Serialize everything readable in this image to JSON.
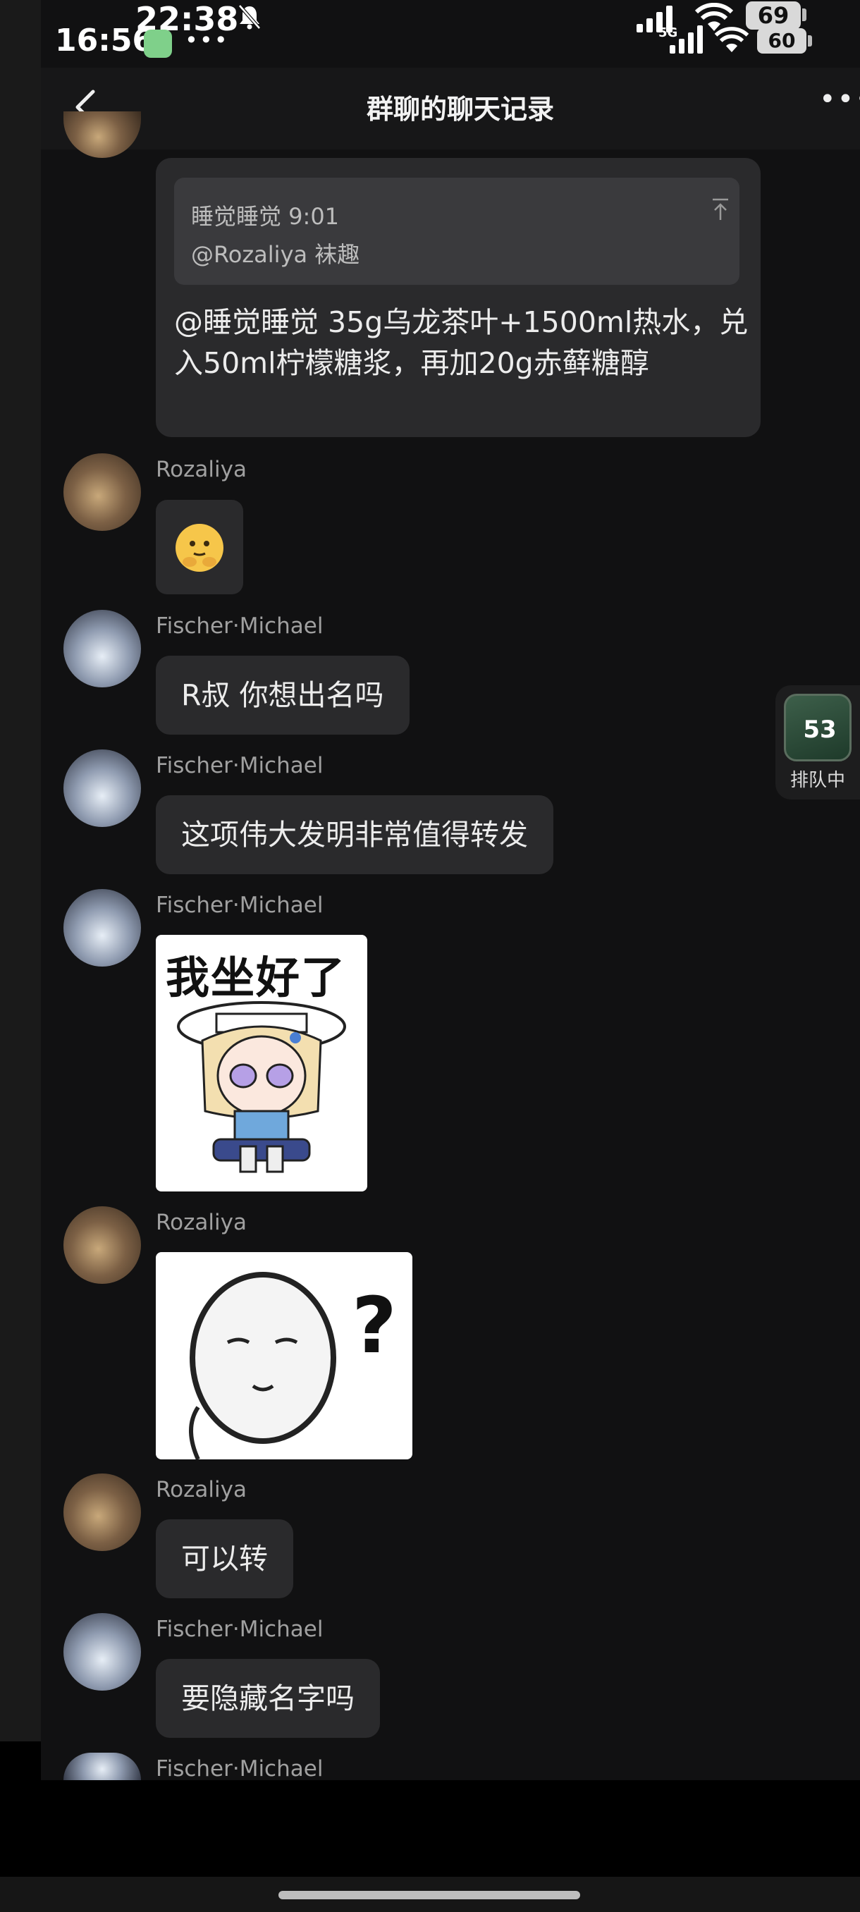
{
  "status_outer": {
    "time": "16:56",
    "dots": "•••",
    "battery": "60"
  },
  "status_inner": {
    "time": "22:38",
    "network": "5G",
    "battery": "69"
  },
  "header": {
    "title": "群聊的聊天记录"
  },
  "quote": {
    "author_time": "睡觉睡觉 9:01",
    "quoted_text": "@Rozaliya 袜趣",
    "reply_text": "@睡觉睡觉 35g乌龙茶叶+1500ml热水，兑入50ml柠檬糖浆，再加20g赤藓糖醇"
  },
  "messages": [
    {
      "sender": "Rozaliya",
      "type": "emoji"
    },
    {
      "sender": "Fischer·Michael",
      "text": "R叔 你想出名吗"
    },
    {
      "sender": "Fischer·Michael",
      "text": "这项伟大发明非常值得转发"
    },
    {
      "sender": "Fischer·Michael",
      "type": "sticker",
      "caption": "我坐好了"
    },
    {
      "sender": "Rozaliya",
      "type": "sticker",
      "caption": "?"
    },
    {
      "sender": "Rozaliya",
      "text": "可以转"
    },
    {
      "sender": "Fischer·Michael",
      "text": "要隐藏名字吗"
    },
    {
      "sender": "Fischer·Michael"
    }
  ],
  "float_badge": {
    "count": "53",
    "label": "排队中"
  },
  "icons": [
    "back-icon",
    "more-icon",
    "bell-off-icon",
    "signal-icon",
    "wifi-icon",
    "battery-icon",
    "pin-top-icon"
  ]
}
